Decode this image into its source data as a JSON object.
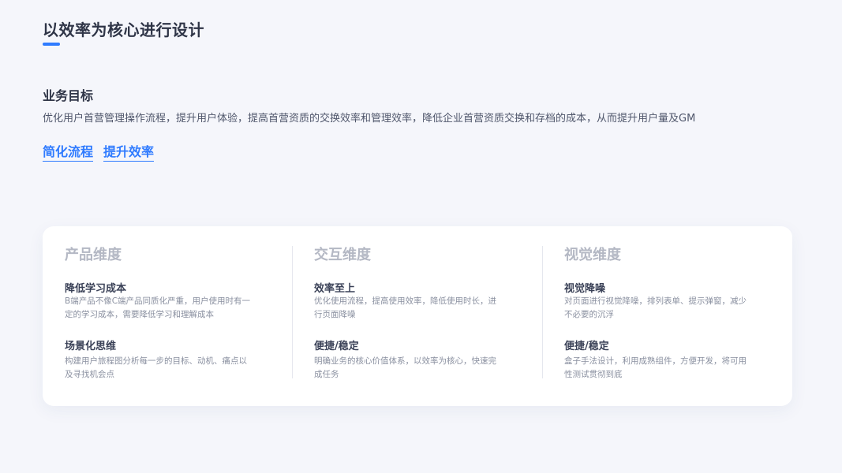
{
  "page": {
    "title": "以效率为核心进行设计"
  },
  "goal": {
    "heading": "业务目标",
    "description": "优化用户首营管理操作流程，提升用户体验，提高首营资质的交换效率和管理效率，降低企业首营资质交换和存档的成本，从而提升用户量及GM",
    "links": [
      "简化流程",
      "提升效率"
    ]
  },
  "dimensions": [
    {
      "title": "产品维度",
      "items": [
        {
          "title": "降低学习成本",
          "desc": "B端产品不像C端产品同质化严重，用户使用时有一定的学习成本，需要降低学习和理解成本"
        },
        {
          "title": "场景化思维",
          "desc": "构建用户旅程图分析每一步的目标、动机、痛点以及寻找机会点"
        }
      ]
    },
    {
      "title": "交互维度",
      "items": [
        {
          "title": "效率至上",
          "desc": "优化使用流程，提高使用效率，降低使用时长，进行页面降噪"
        },
        {
          "title": "便捷/稳定",
          "desc": "明确业务的核心价值体系，以效率为核心，快速完成任务"
        }
      ]
    },
    {
      "title": "视觉维度",
      "items": [
        {
          "title": "视觉降噪",
          "desc": "对页面进行视觉降噪，排列表单、提示弹窗，减少不必要的沉浮"
        },
        {
          "title": "便捷/稳定",
          "desc": "盒子手法设计，利用成熟组件，方便开发，将可用性测试贯彻到底"
        }
      ]
    }
  ],
  "colors": {
    "accent": "#2f7bff",
    "background": "#f5f6fb",
    "card": "#ffffff",
    "muted_heading": "#b4b8c4"
  }
}
